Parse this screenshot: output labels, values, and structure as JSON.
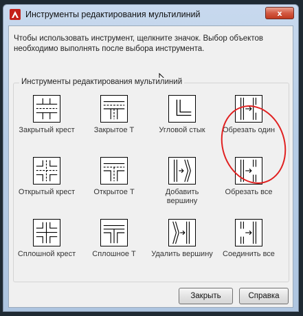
{
  "window": {
    "title": "Инструменты редактирования мультилиний",
    "close_glyph": "x"
  },
  "instruction": "Чтобы использовать инструмент, щелкните значок. Выбор объектов необходимо выполнять после выбора инструмента.",
  "group_title": "Инструменты редактирования мультилиний",
  "tools": [
    {
      "label": "Закрытый крест",
      "icon": "closed-cross-icon"
    },
    {
      "label": "Закрытое Т",
      "icon": "closed-tee-icon"
    },
    {
      "label": "Угловой стык",
      "icon": "corner-joint-icon"
    },
    {
      "label": "Обрезать один",
      "icon": "cut-single-icon"
    },
    {
      "label": "Открытый крест",
      "icon": "open-cross-icon"
    },
    {
      "label": "Открытое Т",
      "icon": "open-tee-icon"
    },
    {
      "label": "Добавить вершину",
      "icon": "add-vertex-icon"
    },
    {
      "label": "Обрезать все",
      "icon": "cut-all-icon"
    },
    {
      "label": "Сплошной крест",
      "icon": "merged-cross-icon"
    },
    {
      "label": "Сплошное Т",
      "icon": "merged-tee-icon"
    },
    {
      "label": "Удалить вершину",
      "icon": "delete-vertex-icon"
    },
    {
      "label": "Соединить все",
      "icon": "weld-all-icon"
    }
  ],
  "buttons": {
    "close": "Закрыть",
    "help": "Справка"
  },
  "colors": {
    "title_bar": "#b7cde6",
    "close_button": "#c0391f",
    "annotation_circle": "#e02020"
  }
}
